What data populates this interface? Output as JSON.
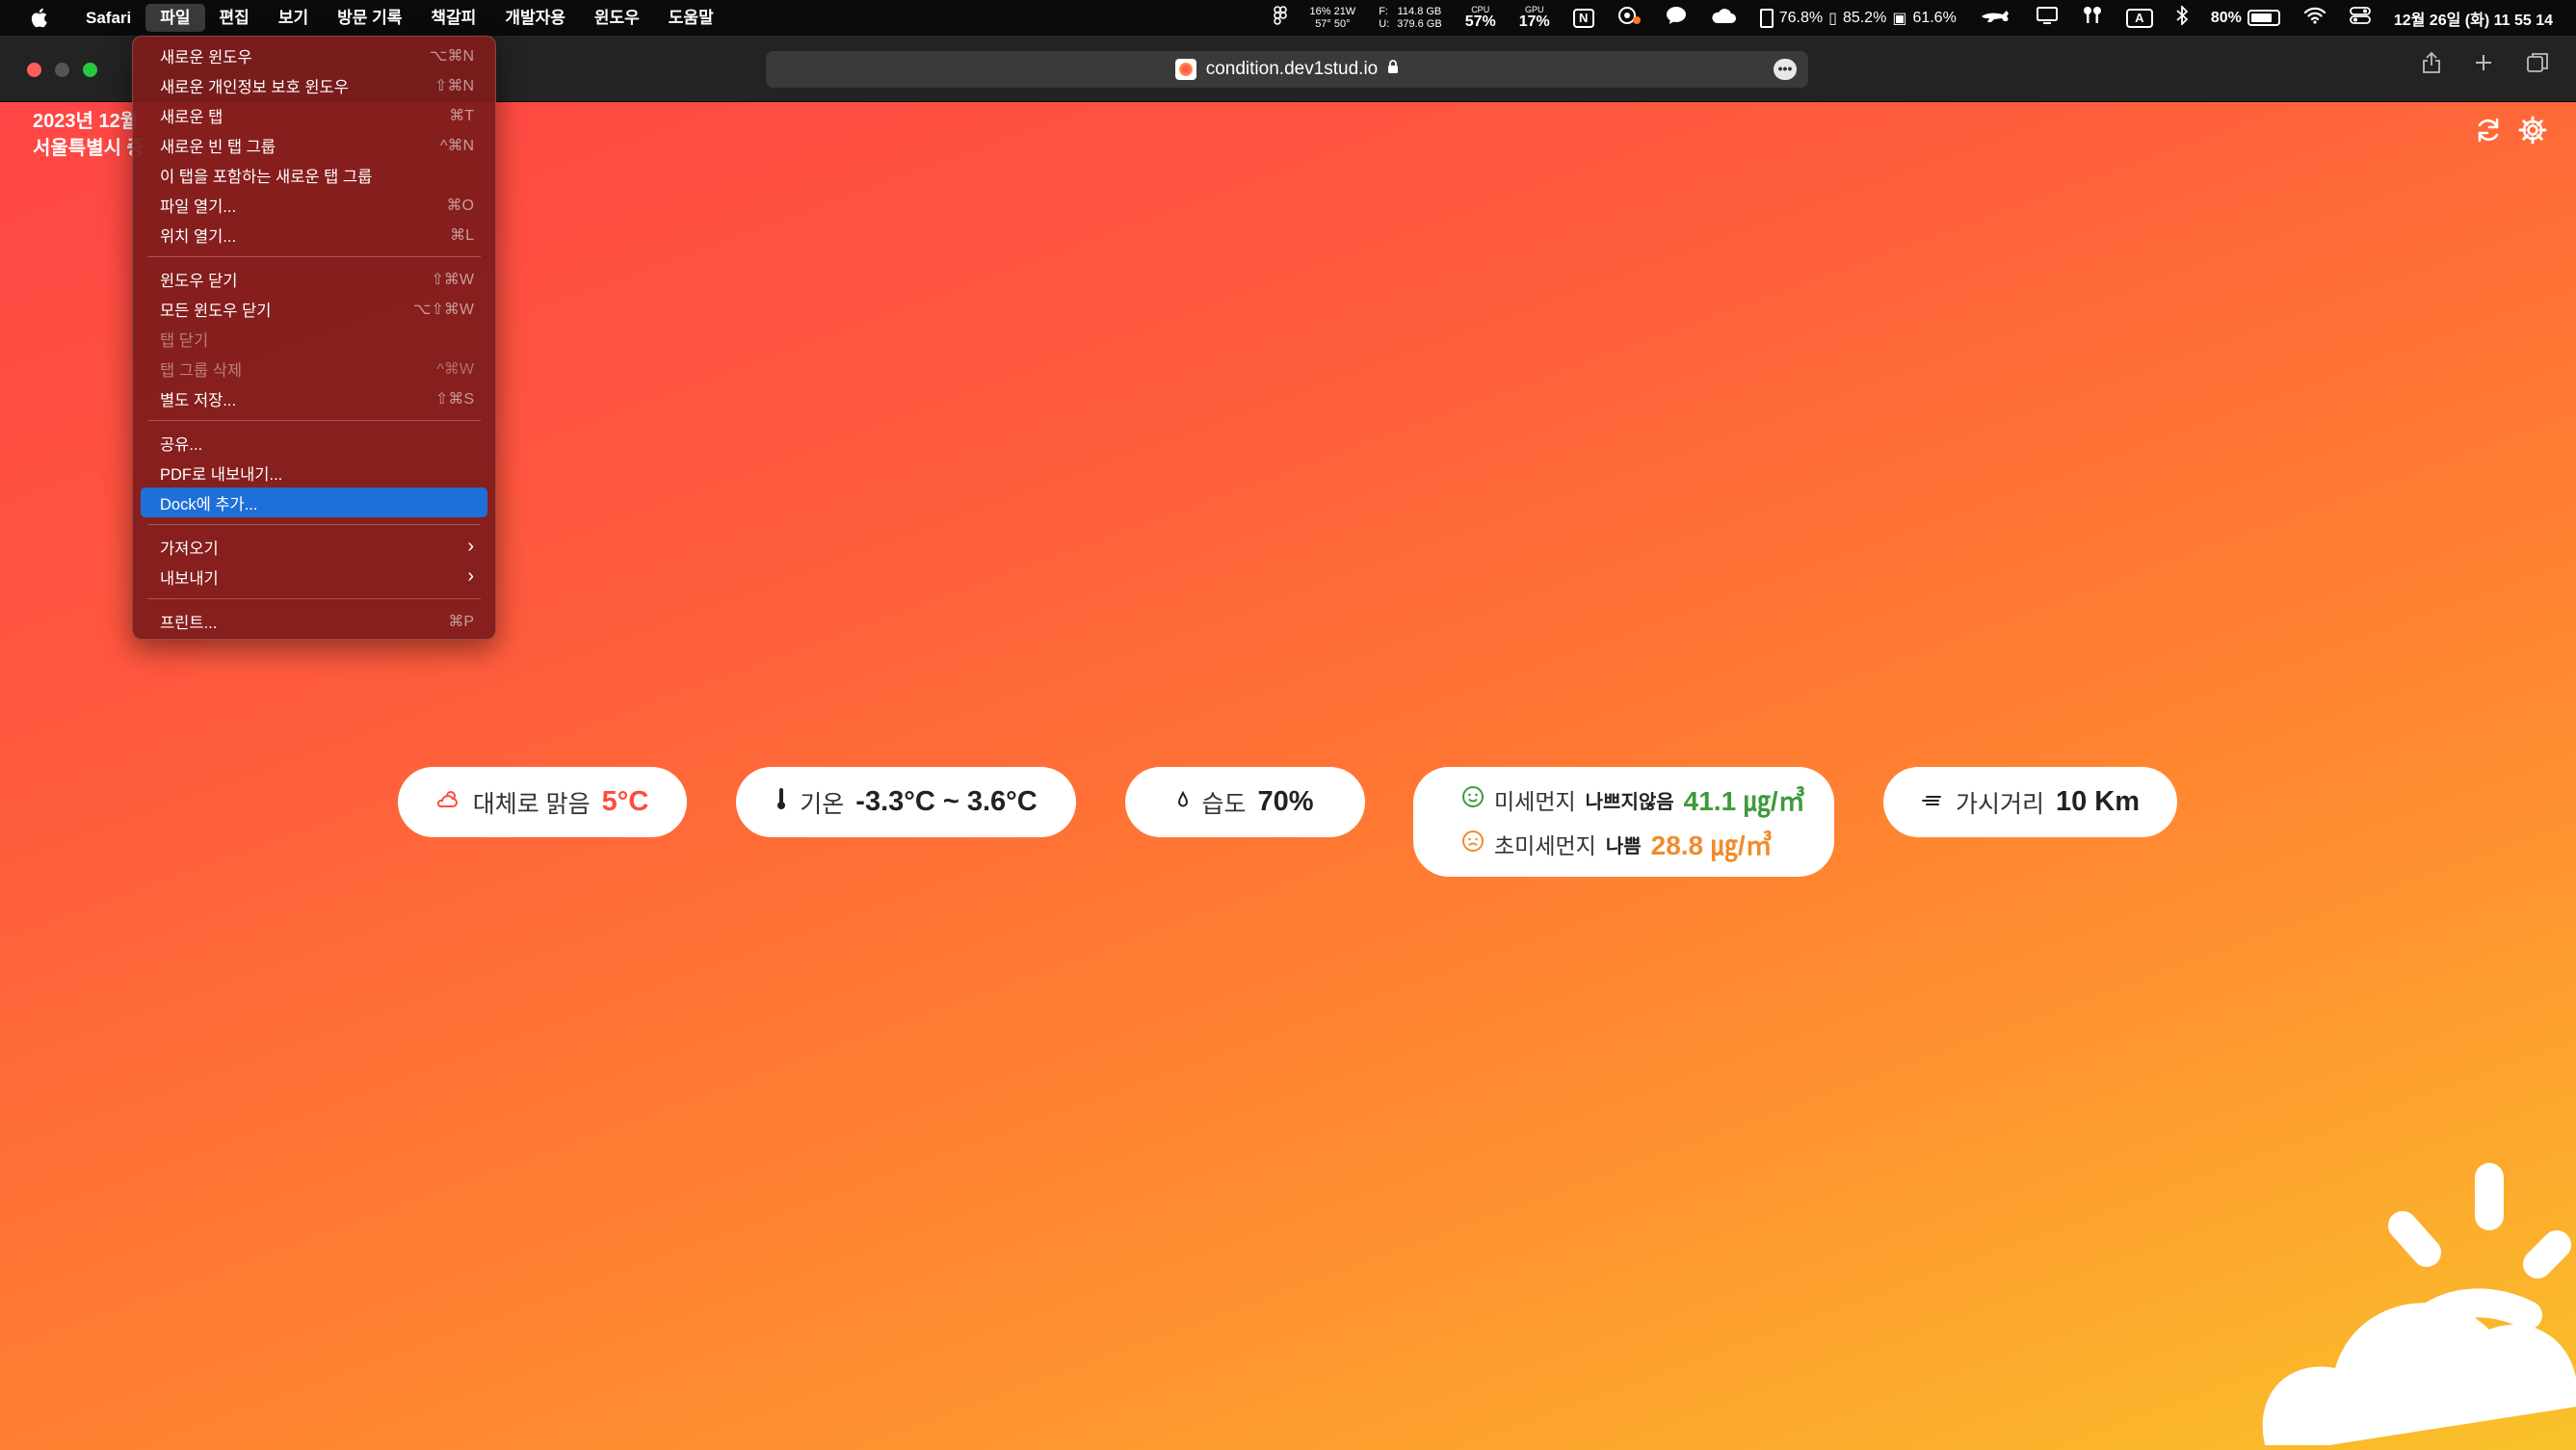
{
  "menubar": {
    "app_name": "Safari",
    "menus": [
      "파일",
      "편집",
      "보기",
      "방문 기록",
      "책갈피",
      "개발자용",
      "윈도우",
      "도움말"
    ],
    "weather_top": "16% 21W",
    "weather_bottom": "57° 50°",
    "disk_label_top": "F:",
    "disk_label_bottom": "U:",
    "disk_top": "114.8 GB",
    "disk_bottom": "379.6 GB",
    "cpu_label": "CPU",
    "cpu_value": "57%",
    "gpu_label": "GPU",
    "gpu_value": "17%",
    "notion_letter": "N",
    "mem_1": "76.8%",
    "mem_2": "85.2%",
    "mem_3": "61.6%",
    "input_letter": "A",
    "battery": "80%",
    "datetime": "12월 26일 (화) 11 55 14"
  },
  "toolbar": {
    "url": "condition.dev1stud.io",
    "more": "•••"
  },
  "location": {
    "line1": "2023년 12월",
    "line2": "서울특별시 중"
  },
  "pills": {
    "sky_label": "대체로 맑음",
    "sky_temp": "5°C",
    "temp_label": "기온",
    "temp_range": "-3.3°C ~ 3.6°C",
    "humidity_label": "습도",
    "humidity_value": "70%",
    "pm10_label": "미세먼지",
    "pm10_status": "나쁘지않음",
    "pm10_value": "41.1 ㎍/㎥",
    "pm25_label": "초미세먼지",
    "pm25_status": "나쁨",
    "pm25_value": "28.8 ㎍/㎥",
    "visibility_label": "가시거리",
    "visibility_value": "10 Km"
  },
  "file_menu": {
    "items": [
      {
        "label": "새로운 윈도우",
        "shortcut": "⌥⌘N"
      },
      {
        "label": "새로운 개인정보 보호 윈도우",
        "shortcut": "⇧⌘N"
      },
      {
        "label": "새로운 탭",
        "shortcut": "⌘T"
      },
      {
        "label": "새로운 빈 탭 그룹",
        "shortcut": "^⌘N"
      },
      {
        "label": "이 탭을 포함하는 새로운 탭 그룹",
        "shortcut": ""
      },
      {
        "label": "파일 열기...",
        "shortcut": "⌘O"
      },
      {
        "label": "위치 열기...",
        "shortcut": "⌘L"
      },
      {
        "label": "윈도우 닫기",
        "shortcut": "⇧⌘W"
      },
      {
        "label": "모든 윈도우 닫기",
        "shortcut": "⌥⇧⌘W"
      },
      {
        "label": "탭 닫기",
        "shortcut": ""
      },
      {
        "label": "탭 그룹 삭제",
        "shortcut": "^⌘W"
      },
      {
        "label": "별도 저장...",
        "shortcut": "⇧⌘S"
      },
      {
        "label": "공유...",
        "shortcut": ""
      },
      {
        "label": "PDF로 내보내기...",
        "shortcut": ""
      },
      {
        "label": "Dock에 추가...",
        "shortcut": ""
      },
      {
        "label": "가져오기",
        "shortcut": ""
      },
      {
        "label": "내보내기",
        "shortcut": ""
      },
      {
        "label": "프린트...",
        "shortcut": "⌘P"
      }
    ]
  }
}
